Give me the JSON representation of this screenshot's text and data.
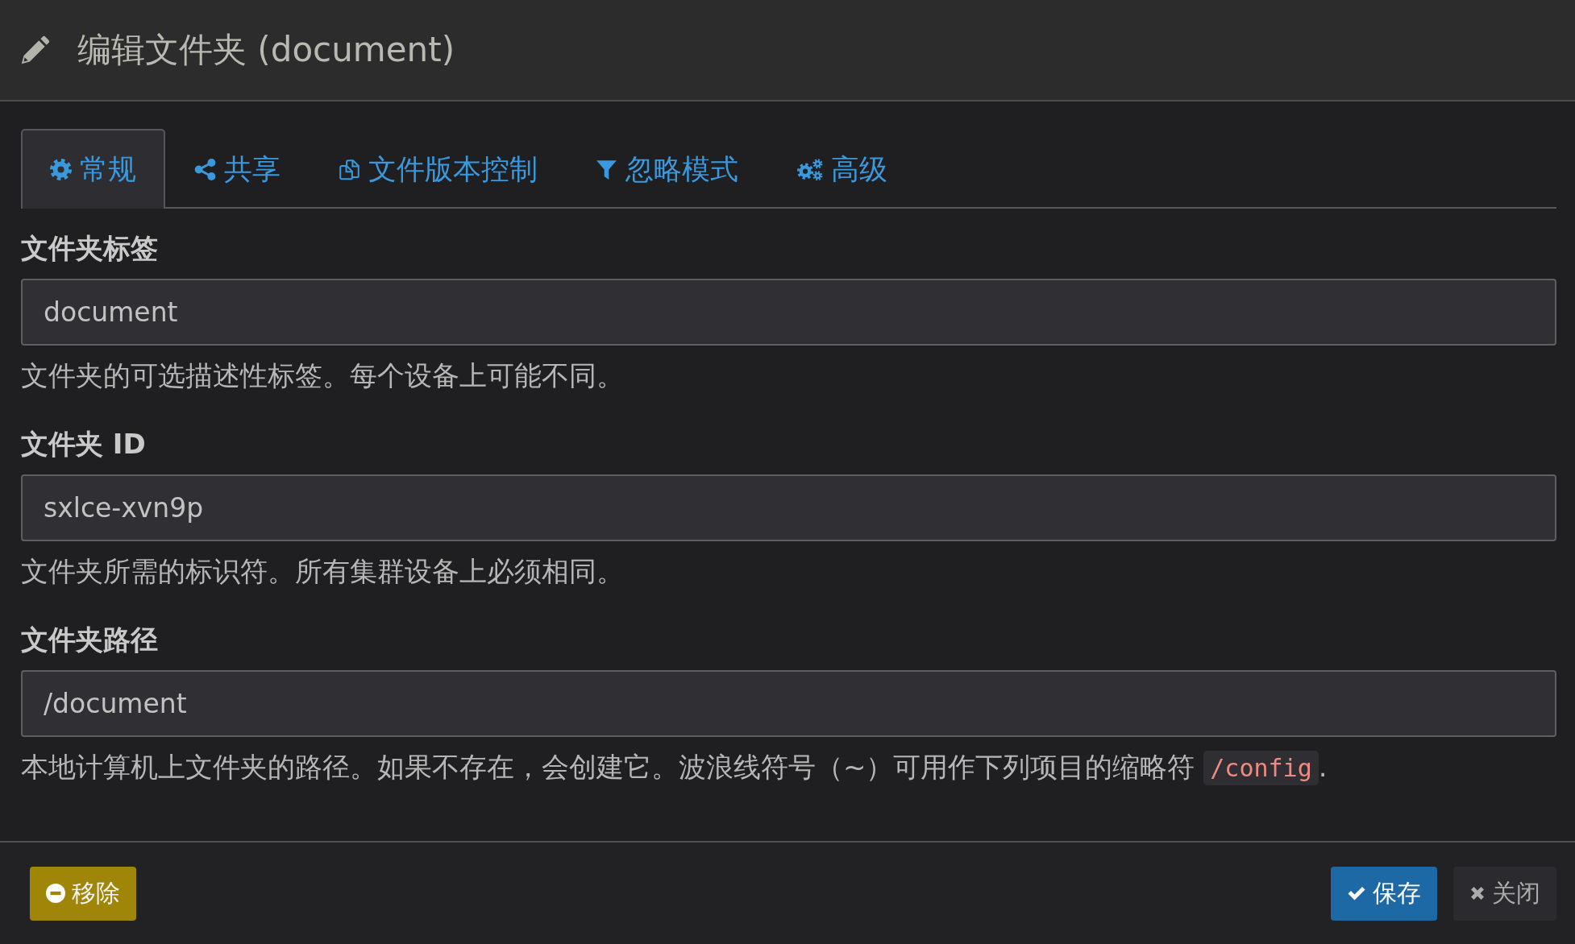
{
  "dialog": {
    "title": "编辑文件夹 (document)"
  },
  "tabs": [
    {
      "label": "常规",
      "selected": true
    },
    {
      "label": "共享",
      "selected": false
    },
    {
      "label": "文件版本控制",
      "selected": false
    },
    {
      "label": "忽略模式",
      "selected": false
    },
    {
      "label": "高级",
      "selected": false
    }
  ],
  "fields": [
    {
      "label": "文件夹标签",
      "value": "document",
      "help": "文件夹的可选描述性标签。每个设备上可能不同。"
    },
    {
      "label": "文件夹 ID",
      "value": "sxlce-xvn9p",
      "help": "文件夹所需的标识符。所有集群设备上必须相同。"
    },
    {
      "label": "文件夹路径",
      "value": "/document",
      "help": "本地计算机上文件夹的路径。如果不存在，会创建它。波浪线符号（~）可用作下列项目的缩略符",
      "help_code": "/config",
      "help_end": "."
    }
  ],
  "footer": {
    "buttons": [
      {
        "label": "移除",
        "kind": "remove"
      },
      {
        "label": "保存",
        "kind": "save"
      },
      {
        "label": "关闭",
        "kind": "close"
      }
    ]
  }
}
